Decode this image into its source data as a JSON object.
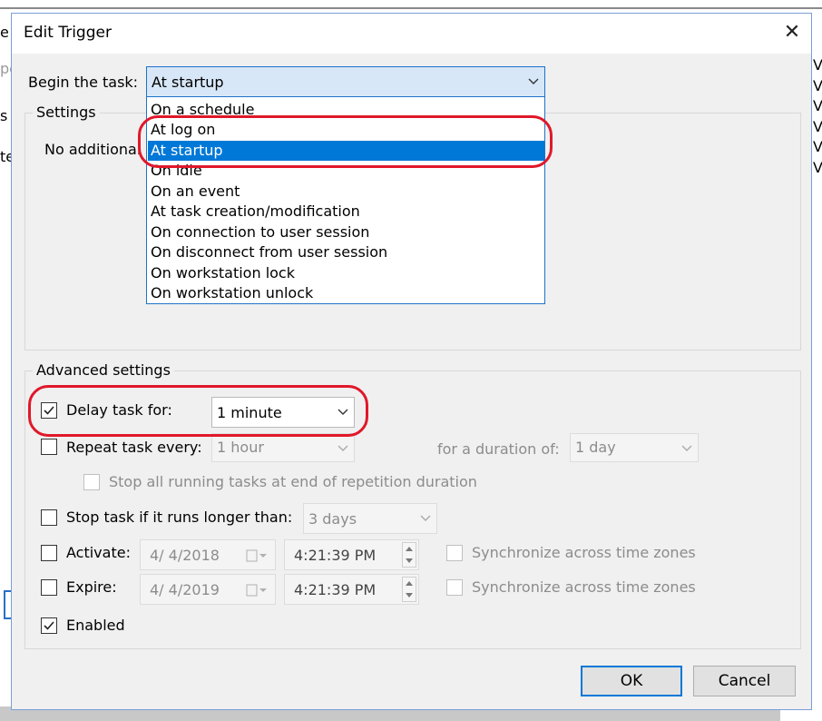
{
  "background_app": {
    "left_fragments": [
      "e",
      "pe",
      "s",
      "te"
    ],
    "right_fragments": [
      "V",
      "V",
      "V",
      "V",
      "V",
      "V"
    ]
  },
  "dialog": {
    "title": "Edit Trigger",
    "close_glyph": "✕",
    "begin_label": "Begin the task:",
    "begin_value": "At startup",
    "dropdown_options": [
      "On a schedule",
      "At log on",
      "At startup",
      "On idle",
      "On an event",
      "At task creation/modification",
      "On connection to user session",
      "On disconnect from user session",
      "On workstation lock",
      "On workstation unlock"
    ],
    "dropdown_selected": "At startup",
    "settings_group": "Settings",
    "settings_text": "No additional",
    "advanced_group": "Advanced settings",
    "delay_label": "Delay task for:",
    "delay_checked": true,
    "delay_value": "1 minute",
    "repeat_label": "Repeat task every:",
    "repeat_checked": false,
    "repeat_value": "1 hour",
    "duration_label": "for a duration of:",
    "duration_value": "1 day",
    "stop_running_label": "Stop all running tasks at end of repetition duration",
    "stop_longer_label": "Stop task if it runs longer than:",
    "stop_longer_checked": false,
    "stop_longer_value": "3 days",
    "activate_label": "Activate:",
    "activate_checked": false,
    "activate_date": "4/  4/2018",
    "activate_time": "4:21:39 PM",
    "expire_label": "Expire:",
    "expire_checked": false,
    "expire_date": "4/  4/2019",
    "expire_time": "4:21:39 PM",
    "sync_label": "Synchronize across time zones",
    "enabled_label": "Enabled",
    "enabled_checked": true,
    "ok_label": "OK",
    "cancel_label": "Cancel"
  },
  "colors": {
    "highlight": "#0078d7",
    "annotation_ring": "#e0182a",
    "disabled_text": "#8c8c8c"
  }
}
